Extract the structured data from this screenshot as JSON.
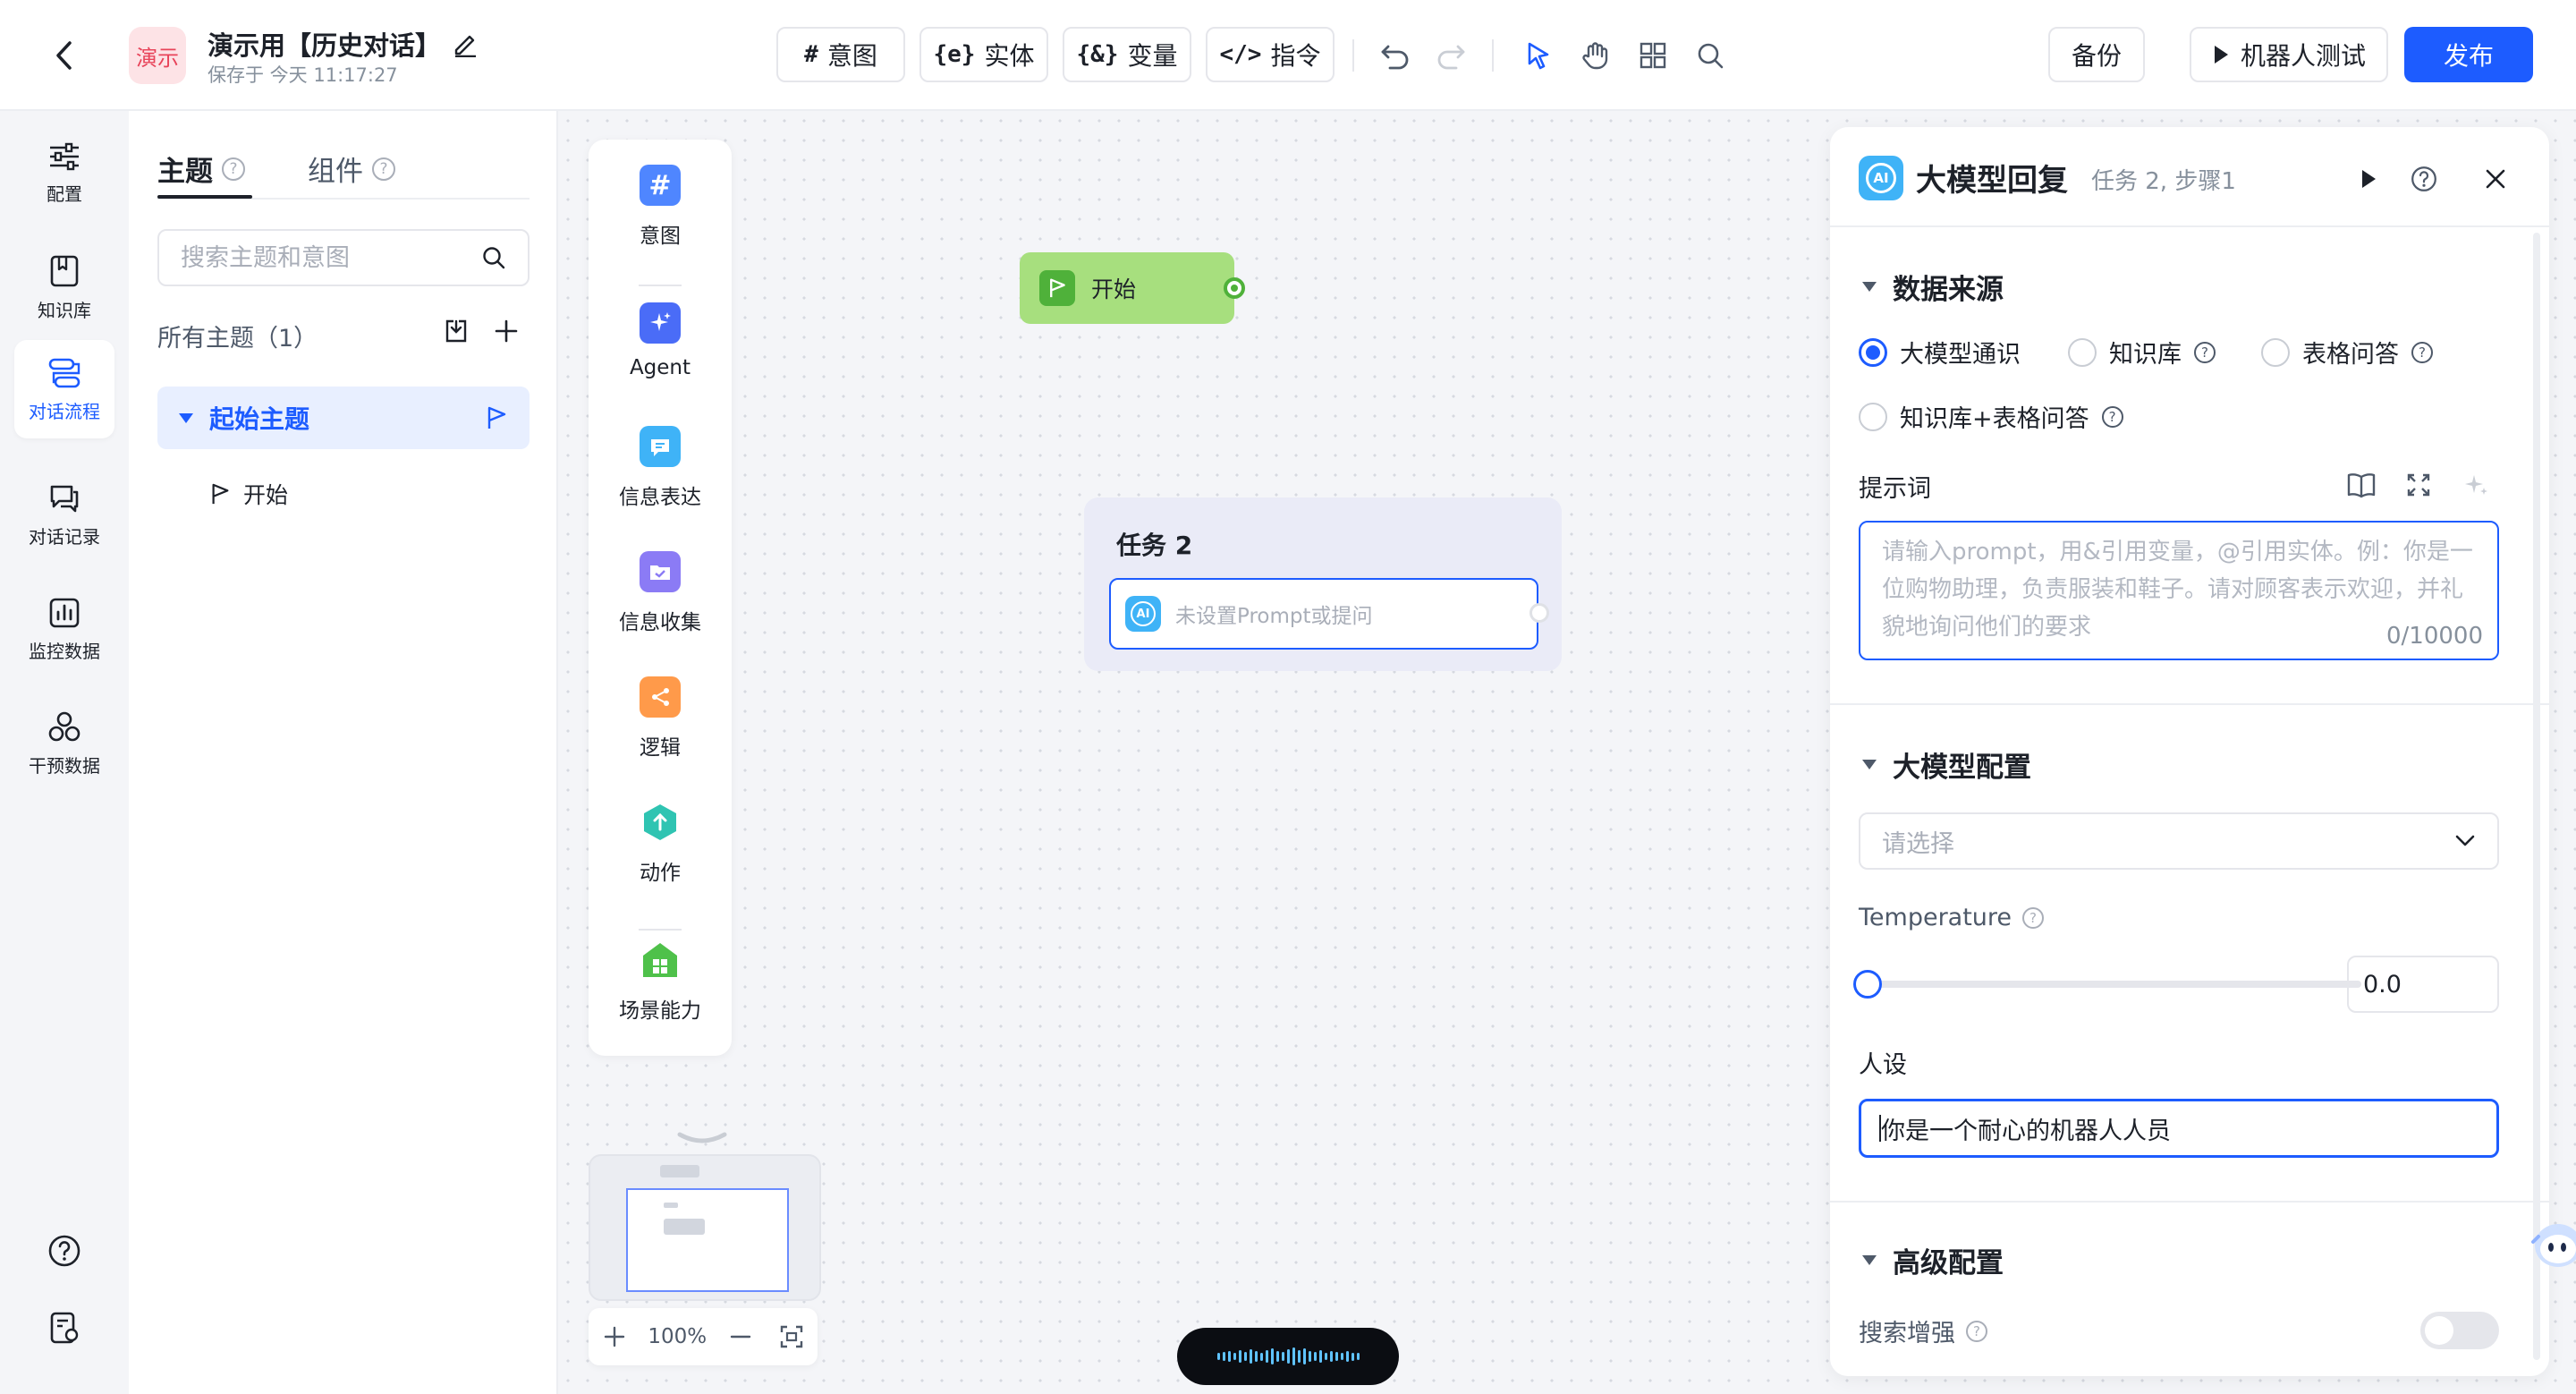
{
  "header": {
    "app_avatar_text": "演示",
    "title": "演示用【历史对话】",
    "saved_text": "保存于 今天 11:17:27",
    "tools": [
      {
        "glyph": "#",
        "label": "意图"
      },
      {
        "glyph": "{e}",
        "label": "实体"
      },
      {
        "glyph": "{&}",
        "label": "变量"
      },
      {
        "glyph": "</>",
        "label": "指令"
      }
    ],
    "backup_label": "备份",
    "robot_test_label": "机器人测试",
    "publish_label": "发布"
  },
  "left_nav": {
    "items": [
      {
        "label": "配置",
        "icon": "sliders-icon"
      },
      {
        "label": "知识库",
        "icon": "book-icon"
      },
      {
        "label": "对话流程",
        "icon": "flow-icon",
        "active": true
      },
      {
        "label": "对话记录",
        "icon": "chat-icon"
      },
      {
        "label": "监控数据",
        "icon": "chart-icon"
      },
      {
        "label": "干预数据",
        "icon": "nodes-icon"
      }
    ]
  },
  "topics_panel": {
    "tab_topics": "主题",
    "tab_components": "组件",
    "search_placeholder": "搜索主题和意图",
    "all_topics_label": "所有主题（1）",
    "topic_name": "起始主题",
    "sub_item": "开始"
  },
  "palette": {
    "items": [
      {
        "label": "意图",
        "color": "#4f86ff"
      },
      {
        "label": "Agent",
        "color": "#4a6cf7"
      },
      {
        "label": "信息表达",
        "color": "#3fb3f7"
      },
      {
        "label": "信息收集",
        "color": "#8b7bf5"
      },
      {
        "label": "逻辑",
        "color": "#ff9a4a"
      },
      {
        "label": "动作",
        "color": "#2fc4b2"
      },
      {
        "label": "场景能力",
        "color": "#4fc14a"
      }
    ]
  },
  "canvas": {
    "start_node_label": "开始",
    "task_title": "任务 2",
    "task_step_placeholder": "未设置Prompt或提问",
    "zoom_level": "100%"
  },
  "config_panel": {
    "title": "大模型回复",
    "subtitle": "任务 2, 步骤1",
    "section_source": "数据来源",
    "radio_options": [
      "大模型通识",
      "知识库",
      "表格问答",
      "知识库+表格问答"
    ],
    "selected_source": "大模型通识",
    "prompt_label": "提示词",
    "prompt_placeholder": "请输入prompt，用&引用变量，@引用实体。例：你是一位购物助理，负责服装和鞋子。请对顾客表示欢迎，并礼貌地询问他们的要求",
    "prompt_count": "0/10000",
    "section_model": "大模型配置",
    "model_select_placeholder": "请选择",
    "temperature_label": "Temperature",
    "temperature_value": "0.0",
    "persona_label": "人设",
    "persona_value": "你是一个耐心的机器人人员",
    "section_advanced": "高级配置",
    "search_enhance_label": "搜索增强",
    "search_enhance_on": false
  },
  "colors": {
    "accent": "#1d5cff",
    "start_node": "#a7df7e",
    "ai_badge": "#3fb3f7"
  }
}
